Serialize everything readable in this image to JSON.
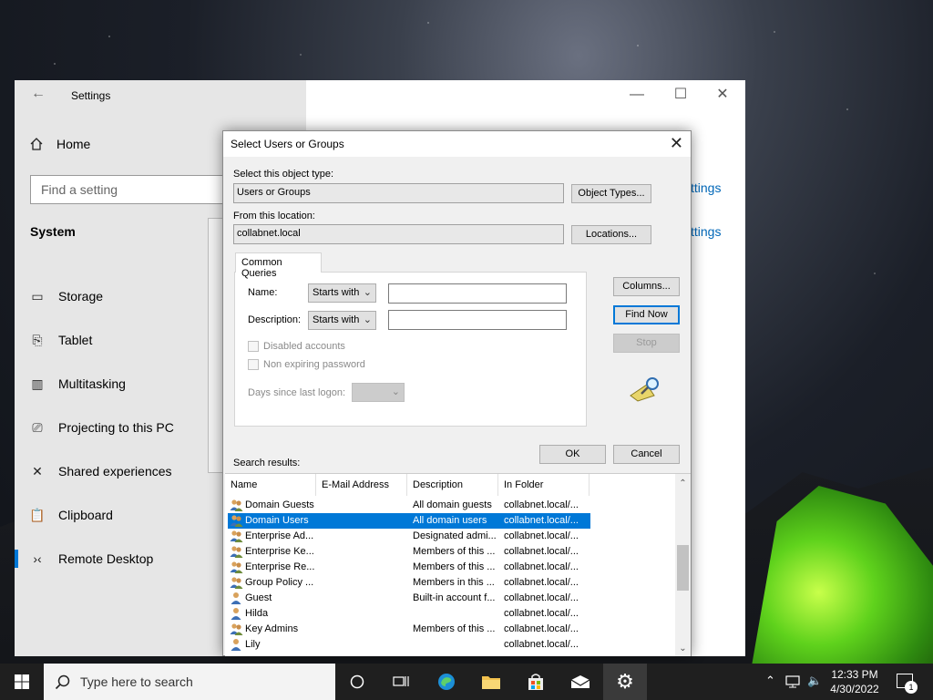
{
  "settings": {
    "title": "Settings",
    "home_label": "Home",
    "search_placeholder": "Find a setting",
    "section_heading": "System",
    "nav_items": [
      {
        "label": "Storage",
        "icon": "storage-icon",
        "glyph": "▭"
      },
      {
        "label": "Tablet",
        "icon": "tablet-icon",
        "glyph": "⎘"
      },
      {
        "label": "Multitasking",
        "icon": "multitasking-icon",
        "glyph": "▥"
      },
      {
        "label": "Projecting to this PC",
        "icon": "projecting-icon",
        "glyph": "⎚"
      },
      {
        "label": "Shared experiences",
        "icon": "shared-experiences-icon",
        "glyph": "✕"
      },
      {
        "label": "Clipboard",
        "icon": "clipboard-icon",
        "glyph": "📋"
      },
      {
        "label": "Remote Desktop",
        "icon": "remote-desktop-icon",
        "glyph": "›‹"
      }
    ],
    "active_nav": "Remote Desktop",
    "right_links": [
      "ttings",
      "ttings"
    ]
  },
  "dialog": {
    "title": "Select Users or Groups",
    "object_type_label": "Select this object type:",
    "object_type_value": "Users or Groups",
    "object_types_button": "Object Types...",
    "location_label": "From this location:",
    "location_value": "collabnet.local",
    "locations_button": "Locations...",
    "tab_label": "Common Queries",
    "name_label": "Name:",
    "name_mode": "Starts with",
    "description_label": "Description:",
    "description_mode": "Starts with",
    "disabled_accounts_label": "Disabled accounts",
    "non_expiring_label": "Non expiring password",
    "days_since_label": "Days since last logon:",
    "columns_button": "Columns...",
    "find_now_button": "Find Now",
    "stop_button": "Stop",
    "ok_button": "OK",
    "cancel_button": "Cancel",
    "results_label": "Search results:",
    "columns": [
      "Name",
      "E-Mail Address",
      "Description",
      "In Folder"
    ],
    "rows": [
      {
        "name": "Domain Guests",
        "email": "",
        "description": "All domain guests",
        "folder": "collabnet.local/...",
        "kind": "group"
      },
      {
        "name": "Domain Users",
        "email": "",
        "description": "All domain users",
        "folder": "collabnet.local/...",
        "kind": "group",
        "selected": true
      },
      {
        "name": "Enterprise Ad...",
        "email": "",
        "description": "Designated admi...",
        "folder": "collabnet.local/...",
        "kind": "group"
      },
      {
        "name": "Enterprise Ke...",
        "email": "",
        "description": "Members of this ...",
        "folder": "collabnet.local/...",
        "kind": "group"
      },
      {
        "name": "Enterprise Re...",
        "email": "",
        "description": "Members of this ...",
        "folder": "collabnet.local/...",
        "kind": "group"
      },
      {
        "name": "Group Policy ...",
        "email": "",
        "description": "Members in this ...",
        "folder": "collabnet.local/...",
        "kind": "group"
      },
      {
        "name": "Guest",
        "email": "",
        "description": "Built-in account f...",
        "folder": "collabnet.local/...",
        "kind": "user"
      },
      {
        "name": "Hilda",
        "email": "",
        "description": "",
        "folder": "collabnet.local/...",
        "kind": "user"
      },
      {
        "name": "Key Admins",
        "email": "",
        "description": "Members of this ...",
        "folder": "collabnet.local/...",
        "kind": "group"
      },
      {
        "name": "Lily",
        "email": "",
        "description": "",
        "folder": "collabnet.local/...",
        "kind": "user"
      }
    ]
  },
  "taskbar": {
    "search_placeholder": "Type here to search",
    "time": "12:33 PM",
    "date": "4/30/2022",
    "notification_count": "1"
  },
  "colors": {
    "accent": "#0078d7",
    "selection": "#0078d7"
  }
}
